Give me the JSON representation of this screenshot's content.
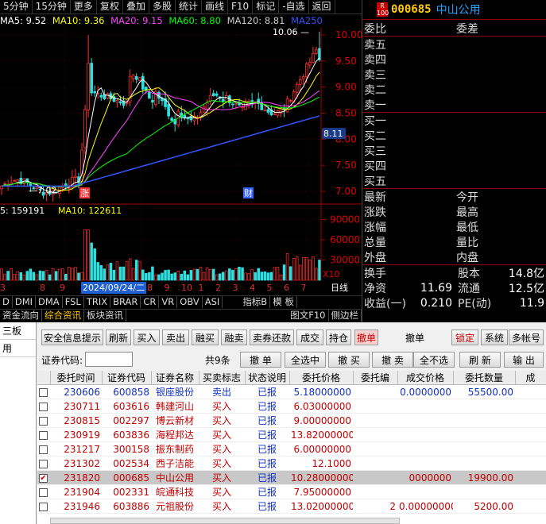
{
  "toolbar": [
    "5分钟",
    "15分钟",
    "更多",
    "复权",
    "叠加",
    "多股",
    "统计",
    "画线",
    "F10",
    "标记",
    "-自选",
    "返回"
  ],
  "ma": {
    "ma5": "MA5: 9.52",
    "ma10": "MA10: 9.36",
    "ma20": "MA20: 9.15",
    "ma60": "MA60: 8.80",
    "ma120": "MA120: 8.81",
    "ma250": "MA250",
    "colors": {
      "ma5": "#ffffff",
      "ma10": "#ffff00",
      "ma20": "#ff44ff",
      "ma60": "#00ff00",
      "ma120": "#cccccc",
      "ma250": "#3355ff"
    }
  },
  "price_axis": [
    "10.00",
    "9.50",
    "9.00",
    "8.50",
    "8.00",
    "7.50",
    "7.00"
  ],
  "price_marker": "8.11",
  "high_label": "10.06",
  "low_label": "7.02",
  "event_markers": [
    "涨",
    "财"
  ],
  "vol_line": {
    "v5": "5: 159191",
    "v10": "MA10: 122611"
  },
  "vol_axis": [
    "90000",
    "60000",
    "30000"
  ],
  "vol_unit": "X10",
  "date_row": {
    "highlight": "2024/09/24/二",
    "nums_left": [
      "3",
      "8",
      "9"
    ],
    "nums_right": [
      "8",
      "9",
      "10",
      "1",
      "2",
      "3",
      "4",
      "5",
      "6",
      "7"
    ],
    "period": "日线"
  },
  "indicator_tabs": [
    "D",
    "DMI",
    "DMA",
    "FSL",
    "TRIX",
    "BRAR",
    "CR",
    "VR",
    "OBV",
    "ASI",
    "指标B",
    "模 板"
  ],
  "info_tabs": [
    "资金流向",
    "综合资讯",
    "板块资讯",
    "图文F10",
    "侧边栏"
  ],
  "right_panel": {
    "code": "000685",
    "name": "中山公用",
    "weibi": "委比",
    "weicha": "委差",
    "sells": [
      "卖五",
      "卖四",
      "卖三",
      "卖二",
      "卖一"
    ],
    "buys": [
      "买一",
      "买二",
      "买三",
      "买四",
      "买五"
    ],
    "stats": [
      {
        "l": "最新",
        "m": "今开",
        "v": ""
      },
      {
        "l": "涨跌",
        "m": "最高",
        "v": ""
      },
      {
        "l": "涨幅",
        "m": "最低",
        "v": ""
      },
      {
        "l": "总量",
        "m": "量比",
        "v": ""
      },
      {
        "l": "外盘",
        "m": "内盘",
        "v": ""
      }
    ],
    "stats2": [
      {
        "l": "换手",
        "lv": "",
        "m": "股本",
        "v": "14.8亿"
      },
      {
        "l": "净资",
        "lv": "11.69",
        "m": "流通",
        "v": "12.5亿"
      },
      {
        "l": "收益(一)",
        "lv": "0.210",
        "m": "PE(动)",
        "v": "11.9"
      }
    ]
  },
  "trade": {
    "left_items": [
      "三板",
      "用"
    ],
    "top_buttons": [
      "安全信息提示",
      "刷新",
      "买入",
      "卖出",
      "融买",
      "融卖",
      "卖券还款",
      "成交",
      "持仓",
      "撤单"
    ],
    "withdraw_label": "撤单",
    "right_buttons": [
      "锁定",
      "系统",
      "多帐号"
    ],
    "code_label": "证券代码:",
    "count": "共9条",
    "action_buttons": [
      "撤 单",
      "全选中",
      "撤 买",
      "撤 卖",
      "全不选",
      "刷 新",
      "输 出"
    ],
    "headers": [
      "委托时间",
      "证券代码",
      "证券名称",
      "买卖标志",
      "状态说明",
      "委托价格",
      "委托编",
      "成交价格",
      "委托数量",
      "成"
    ],
    "rows": [
      {
        "time": "230606",
        "code": "600858",
        "name": "银座股份",
        "side": "卖出",
        "status": "已报",
        "price": "5.18000000",
        "no": "",
        "deal": "0.0000000",
        "qty": "55500.00",
        "checked": false,
        "sell": true
      },
      {
        "time": "230711",
        "code": "603616",
        "name": "韩建河山",
        "side": "买入",
        "status": "已报",
        "price": "6.03000000",
        "no": "",
        "deal": "",
        "qty": "",
        "checked": false,
        "sell": false
      },
      {
        "time": "230815",
        "code": "002297",
        "name": "博云新材",
        "side": "买入",
        "status": "已报",
        "price": "9.00000000",
        "no": "",
        "deal": "",
        "qty": "",
        "checked": false,
        "sell": false
      },
      {
        "time": "230919",
        "code": "603836",
        "name": "海程邦达",
        "side": "买入",
        "status": "已报",
        "price": "13.82000000",
        "no": "",
        "deal": "",
        "qty": "",
        "checked": false,
        "sell": false
      },
      {
        "time": "231217",
        "code": "300158",
        "name": "振东制药",
        "side": "买入",
        "status": "已报",
        "price": "6.00000000",
        "no": "",
        "deal": "",
        "qty": "",
        "checked": false,
        "sell": false
      },
      {
        "time": "231302",
        "code": "002534",
        "name": "西子洁能",
        "side": "买入",
        "status": "已报",
        "price": "12.1000",
        "no": "",
        "deal": "",
        "qty": "",
        "checked": false,
        "sell": false
      },
      {
        "time": "231820",
        "code": "000685",
        "name": "中山公用",
        "side": "买入",
        "status": "已报",
        "price": "10.28000000",
        "no": "",
        "deal": "0000000",
        "qty": "19900.00",
        "checked": true,
        "sell": false
      },
      {
        "time": "231904",
        "code": "002331",
        "name": "皖通科技",
        "side": "买入",
        "status": "已报",
        "price": "7.95000000",
        "no": "",
        "deal": "",
        "qty": "",
        "checked": false,
        "sell": false
      },
      {
        "time": "231946",
        "code": "603886",
        "name": "元祖股份",
        "side": "买入",
        "status": "已报",
        "price": "13.02000000",
        "no": "2",
        "deal": "0.00000000",
        "qty": "5200.00",
        "checked": false,
        "sell": false
      }
    ]
  }
}
